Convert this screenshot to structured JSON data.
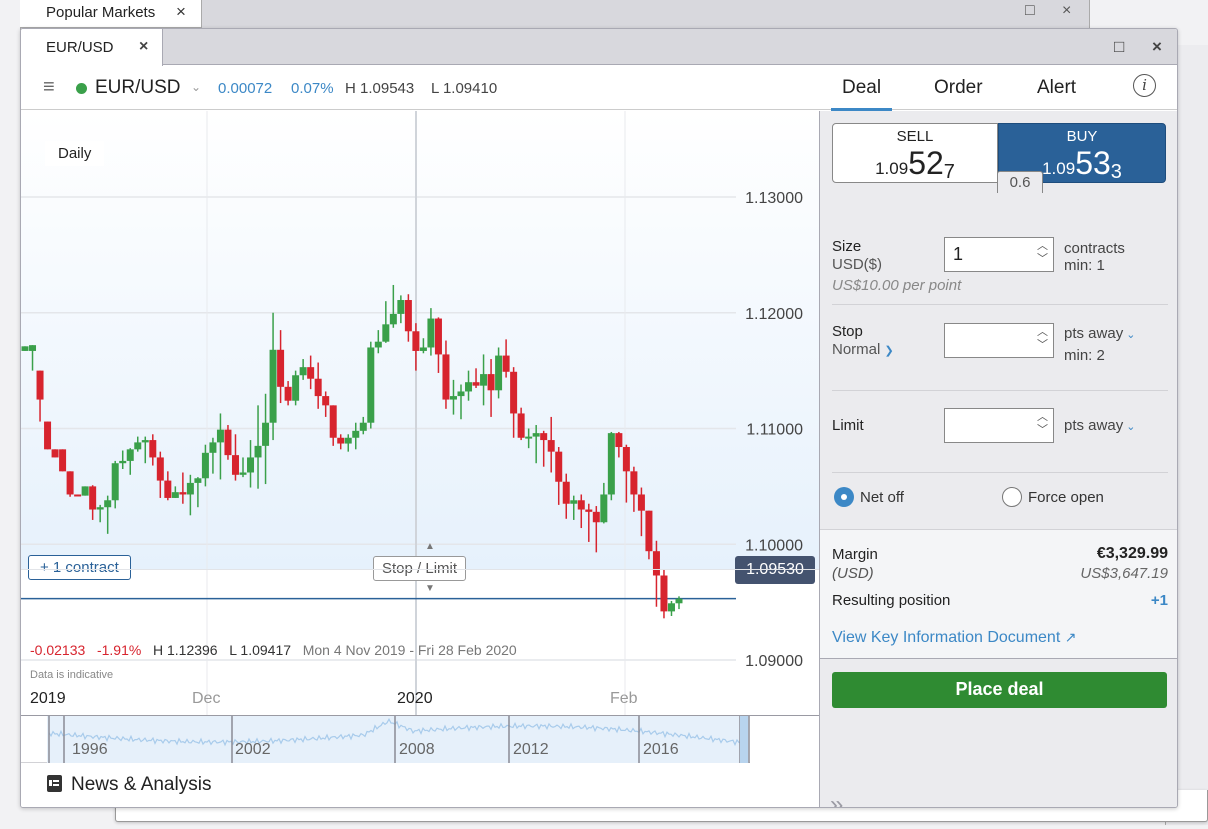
{
  "background_window": {
    "tab_label": "Popular Markets",
    "close_icon": "×",
    "maximize_icon": "□"
  },
  "window": {
    "tab_label": "EUR/USD",
    "close_icon": "×",
    "maximize_icon": "□"
  },
  "header": {
    "menu_icon": "≡",
    "market_status": "open",
    "market_status_color": "#3aa04a",
    "symbol": "EUR/USD",
    "dropdown_icon": "⌄",
    "change": "0.00072",
    "change_pct": "0.07%",
    "high": "H 1.09543",
    "low": "L 1.09410"
  },
  "deal_tabs": {
    "items": [
      {
        "label": "Deal",
        "active": true
      },
      {
        "label": "Order",
        "active": false
      },
      {
        "label": "Alert",
        "active": false
      }
    ],
    "info_icon": "i"
  },
  "ticket": {
    "sell": {
      "label": "SELL",
      "prefix": "1.09",
      "big": "52",
      "small": "7"
    },
    "buy": {
      "label": "BUY",
      "prefix": "1.09",
      "big": "53",
      "small": "3"
    },
    "spread": "0.6",
    "size": {
      "label": "Size",
      "currency": "USD($)",
      "value": "1",
      "unit": "contracts",
      "min": "min: 1",
      "per_point": "US$10.00 per point"
    },
    "stop": {
      "label": "Stop",
      "type": "Normal",
      "value": "",
      "unit": "pts away",
      "min": "min: 2"
    },
    "limit": {
      "label": "Limit",
      "value": "",
      "unit": "pts away"
    },
    "position_mode": {
      "options": [
        {
          "label": "Net off",
          "selected": true
        },
        {
          "label": "Force open",
          "selected": false
        }
      ]
    },
    "margin": {
      "label": "Margin",
      "sub_label": "(USD)",
      "value": "€3,329.99",
      "sub_value": "US$3,647.19"
    },
    "resulting_position": {
      "label": "Resulting position",
      "value": "+1"
    },
    "kid_link": "View Key Information Document",
    "place_deal": "Place deal",
    "expand_icon": "»"
  },
  "chart": {
    "interval": "Daily",
    "position_label": "+ 1 contract",
    "stop_limit_label": "Stop / Limit",
    "current_price": "1.09530",
    "summary": {
      "change": "-0.02133",
      "change_pct": "-1.91%",
      "high": "H 1.12396",
      "low": "L 1.09417",
      "range": "Mon 4 Nov 2019 - Fri 28 Feb 2020"
    },
    "disclaimer": "Data is indicative",
    "x_labels": [
      {
        "label": "2019",
        "strong": true
      },
      {
        "label": "Dec",
        "strong": false
      },
      {
        "label": "2020",
        "strong": true
      },
      {
        "label": "Feb",
        "strong": false
      }
    ],
    "navigator_labels": [
      "1996",
      "2002",
      "2008",
      "2012",
      "2016"
    ]
  },
  "news": {
    "icon": "newspaper-icon",
    "label": "News & Analysis"
  },
  "chart_data": {
    "type": "candlestick",
    "title": "EUR/USD Daily",
    "y_ticks": [
      "1.13000",
      "1.12000",
      "1.11000",
      "1.10000",
      "1.09000"
    ],
    "ylim": [
      1.09,
      1.132
    ],
    "x_tick_labels": [
      "2019",
      "Dec",
      "2020",
      "Feb"
    ],
    "current_price": 1.0953,
    "candles": [
      [
        1.1167,
        1.1171,
        1.1162,
        1.1172
      ],
      [
        1.1167,
        1.1172,
        1.1146,
        1.115
      ],
      [
        1.115,
        1.1125,
        1.1097,
        1.1106
      ],
      [
        1.1106,
        1.1082,
        1.1084,
        1.1085
      ],
      [
        1.1082,
        1.1075,
        1.1074,
        1.1086
      ],
      [
        1.1082,
        1.1063,
        1.1053,
        1.1069
      ],
      [
        1.1063,
        1.1043,
        1.1062,
        1.1041
      ],
      [
        1.1043,
        1.1042,
        1.1036,
        1.1043
      ],
      [
        1.1042,
        1.105,
        1.1025,
        1.105
      ],
      [
        1.105,
        1.103,
        1.1051,
        1.1021
      ],
      [
        1.103,
        1.1032,
        1.1034,
        1.1019
      ],
      [
        1.1032,
        1.1038,
        1.1042,
        1.1009
      ],
      [
        1.1038,
        1.107,
        1.1072,
        1.1031
      ],
      [
        1.107,
        1.1072,
        1.1081,
        1.1065
      ],
      [
        1.1072,
        1.1082,
        1.1083,
        1.106
      ],
      [
        1.1082,
        1.1088,
        1.1093,
        1.108
      ],
      [
        1.1088,
        1.109,
        1.1093,
        1.107
      ],
      [
        1.109,
        1.1075,
        1.1095,
        1.1068
      ],
      [
        1.1075,
        1.1055,
        1.108,
        1.104
      ],
      [
        1.1055,
        1.104,
        1.1063,
        1.1038
      ],
      [
        1.104,
        1.1045,
        1.105,
        1.1045
      ],
      [
        1.1045,
        1.1043,
        1.1062,
        1.1035
      ],
      [
        1.1043,
        1.1053,
        1.106,
        1.1025
      ],
      [
        1.1053,
        1.1057,
        1.1058,
        1.1032
      ],
      [
        1.1057,
        1.1079,
        1.1086,
        1.105
      ],
      [
        1.1079,
        1.1088,
        1.1092,
        1.1061
      ],
      [
        1.1088,
        1.1099,
        1.1113,
        1.1056
      ],
      [
        1.1099,
        1.1077,
        1.1103,
        1.1073
      ],
      [
        1.1077,
        1.106,
        1.1095,
        1.1055
      ],
      [
        1.106,
        1.1062,
        1.1075,
        1.1058
      ],
      [
        1.1062,
        1.1075,
        1.109,
        1.1049
      ],
      [
        1.1075,
        1.1085,
        1.112,
        1.1048
      ],
      [
        1.1085,
        1.1105,
        1.113,
        1.1052
      ],
      [
        1.1105,
        1.1168,
        1.12,
        1.109
      ],
      [
        1.1168,
        1.1136,
        1.1185,
        1.1122
      ],
      [
        1.1136,
        1.1124,
        1.1141,
        1.112
      ],
      [
        1.1124,
        1.1146,
        1.115,
        1.112
      ],
      [
        1.1146,
        1.1153,
        1.116,
        1.1142
      ],
      [
        1.1153,
        1.1143,
        1.1163,
        1.1134
      ],
      [
        1.1143,
        1.1128,
        1.1157,
        1.1117
      ],
      [
        1.1128,
        1.112,
        1.1132,
        1.111
      ],
      [
        1.112,
        1.1092,
        1.112,
        1.1085
      ],
      [
        1.1092,
        1.1087,
        1.1095,
        1.1082
      ],
      [
        1.1087,
        1.1092,
        1.1095,
        1.108
      ],
      [
        1.1092,
        1.1098,
        1.1105,
        1.1082
      ],
      [
        1.1098,
        1.1105,
        1.111,
        1.1095
      ],
      [
        1.1105,
        1.117,
        1.1175,
        1.11
      ],
      [
        1.117,
        1.1175,
        1.1185,
        1.1165
      ],
      [
        1.1175,
        1.119,
        1.121,
        1.1174
      ],
      [
        1.119,
        1.1199,
        1.1224,
        1.1187
      ],
      [
        1.1199,
        1.1211,
        1.1215,
        1.1191
      ],
      [
        1.1211,
        1.1184,
        1.1216,
        1.1175
      ],
      [
        1.1184,
        1.1167,
        1.1191,
        1.115
      ],
      [
        1.1167,
        1.117,
        1.1178,
        1.1165
      ],
      [
        1.117,
        1.1195,
        1.1204,
        1.1163
      ],
      [
        1.1195,
        1.1164,
        1.1196,
        1.1148
      ],
      [
        1.1164,
        1.1125,
        1.1176,
        1.1117
      ],
      [
        1.1125,
        1.1128,
        1.1142,
        1.1112
      ],
      [
        1.1128,
        1.1132,
        1.1138,
        1.1108
      ],
      [
        1.1132,
        1.114,
        1.115,
        1.1124
      ],
      [
        1.114,
        1.1137,
        1.1152,
        1.1135
      ],
      [
        1.1137,
        1.1147,
        1.1164,
        1.112
      ],
      [
        1.1147,
        1.1133,
        1.116,
        1.111
      ],
      [
        1.1133,
        1.1163,
        1.117,
        1.1126
      ],
      [
        1.1163,
        1.1149,
        1.1177,
        1.1144
      ],
      [
        1.1149,
        1.1113,
        1.1153,
        1.1092
      ],
      [
        1.1113,
        1.1092,
        1.1118,
        1.109
      ],
      [
        1.1092,
        1.1093,
        1.11,
        1.1083
      ],
      [
        1.1093,
        1.1096,
        1.1103,
        1.107
      ],
      [
        1.1096,
        1.109,
        1.1098,
        1.1067
      ],
      [
        1.109,
        1.108,
        1.111,
        1.1062
      ],
      [
        1.108,
        1.1054,
        1.1084,
        1.1034
      ],
      [
        1.1054,
        1.1035,
        1.1061,
        1.1022
      ],
      [
        1.1035,
        1.1038,
        1.1042,
        1.1021
      ],
      [
        1.1038,
        1.103,
        1.1043,
        1.1014
      ],
      [
        1.103,
        1.1028,
        1.1035,
        1.1002
      ],
      [
        1.1028,
        1.1019,
        1.1033,
        1.0993
      ],
      [
        1.1019,
        1.1043,
        1.1053,
        1.1018
      ],
      [
        1.1043,
        1.1096,
        1.1097,
        1.1038
      ],
      [
        1.1096,
        1.1084,
        1.1097,
        1.1075
      ],
      [
        1.1084,
        1.1063,
        1.1086,
        1.1036
      ],
      [
        1.1063,
        1.1043,
        1.1067,
        1.1028
      ],
      [
        1.1043,
        1.1029,
        1.1049,
        1.1007
      ],
      [
        1.1029,
        1.0994,
        1.1027,
        1.0987
      ],
      [
        1.0994,
        1.0973,
        1.1003,
        1.0946
      ],
      [
        1.0973,
        1.0942,
        1.0978,
        1.0936
      ],
      [
        1.0942,
        1.0949,
        1.0951,
        1.0938
      ],
      [
        1.0949,
        1.0953,
        1.0955,
        1.0944
      ]
    ],
    "candle_format": [
      "open",
      "close",
      "high",
      "low"
    ],
    "up_color": "#3aa04a",
    "down_color": "#d7242e"
  }
}
